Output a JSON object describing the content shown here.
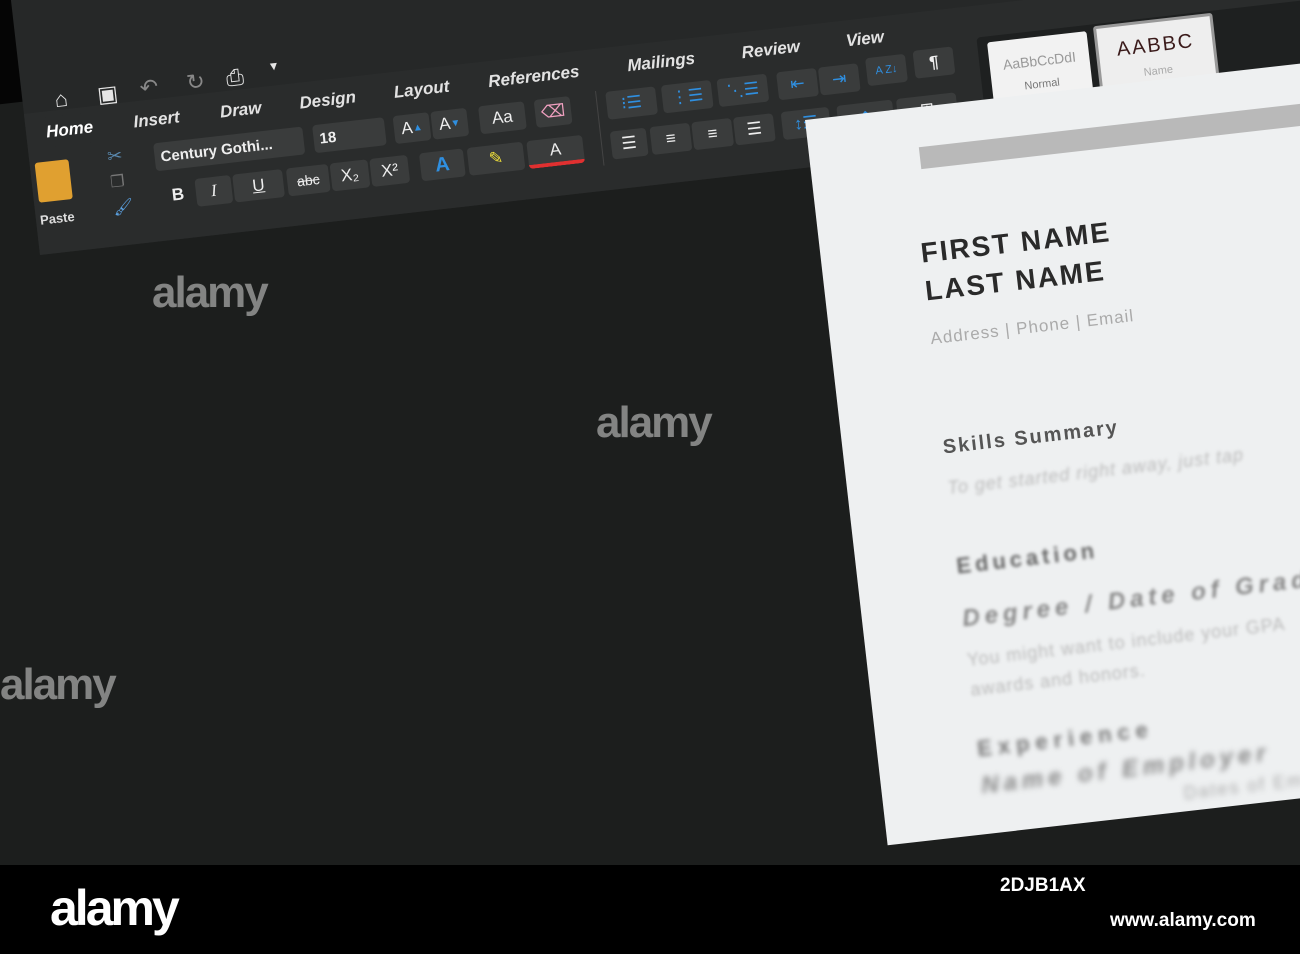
{
  "quick_access": {
    "icons": [
      "home-icon",
      "save-icon",
      "undo-icon",
      "redo-icon",
      "print-icon",
      "customize-icon"
    ]
  },
  "tabs": [
    "Home",
    "Insert",
    "Draw",
    "Design",
    "Layout",
    "References",
    "Mailings",
    "Review",
    "View"
  ],
  "active_tab": "Home",
  "clipboard": {
    "paste_label": "Paste"
  },
  "font": {
    "name": "Century Gothi...",
    "size": "18"
  },
  "format_buttons": {
    "bold": "B",
    "italic": "I",
    "underline": "U",
    "strike": "abc",
    "subscript": "X₂",
    "superscript": "X²",
    "grow": "A",
    "shrink": "A",
    "case": "Aa",
    "text_effects": "A",
    "font_color": "A"
  },
  "paragraph": {
    "pilcrow": "¶",
    "sort": "A Z"
  },
  "styles": [
    {
      "preview": "AaBbCcDdI",
      "name": "Normal"
    },
    {
      "preview": "AABBC",
      "name": "Name"
    }
  ],
  "colors": {
    "accent": "#2f8fe0",
    "highlight": "#f2e23a",
    "font_color": "#e03030"
  },
  "document": {
    "first_name": "FIRST NAME",
    "last_name": "LAST NAME",
    "contact": "Address  |  Phone  |  Email",
    "skills_heading": "Skills Summary",
    "skills_text": "To get started right away, just tap",
    "education_heading": "Education",
    "degree": "Degree / Date of Graduation",
    "edu_text1": "You might want to include your GPA",
    "edu_text2": "awards and honors.",
    "experience_heading": "Experience",
    "employer": "Name of Employer",
    "employment_text": "Dates of Employment"
  },
  "watermark": {
    "brand": "alamy",
    "url": "www.alamy.com",
    "image_code": "2DJB1AX"
  }
}
